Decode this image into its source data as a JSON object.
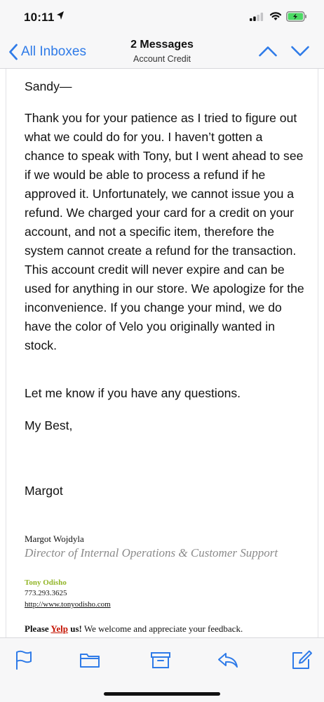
{
  "status_bar": {
    "time": "10:11",
    "icons": [
      "location-arrow-icon",
      "cellular-signal-icon",
      "wifi-icon",
      "battery-charging-icon"
    ]
  },
  "nav": {
    "back_label": "All Inboxes",
    "title": "2 Messages",
    "subtitle": "Account Credit",
    "icons": [
      "chevron-left-icon",
      "chevron-up-icon",
      "chevron-down-icon"
    ]
  },
  "email": {
    "greeting": "Sandy—",
    "paragraphs": [
      "Thank you for your patience as I tried to figure out what we could do for you. I haven’t gotten a chance to speak with Tony, but I went ahead to see if we would be able to process a refund if he approved it. Unfortunately, we cannot issue you a refund. We charged your card for a credit on your account, and not a specific item, therefore the system cannot create a refund for the transaction. This account credit will never expire and can be used for anything in our store. We apologize for the inconvenience. If you change your mind, we do have the color of Velo you originally wanted in stock.",
      "Let me know if you have any questions."
    ],
    "closing": "My Best,",
    "signoff_name": "Margot"
  },
  "signature": {
    "name": "Margot Wojdyla",
    "title": "Director of Internal Operations & Customer Support",
    "company": "Tony Odisho",
    "phone": "773.293.3625",
    "url": "http://www.tonyodisho.com",
    "yelp_prefix": "Please ",
    "yelp_link": "Yelp",
    "yelp_us": " us!",
    "yelp_suffix": " We welcome and appreciate your feedback."
  },
  "toolbar": {
    "icons": [
      "flag-icon",
      "folder-icon",
      "archive-icon",
      "reply-icon",
      "compose-icon"
    ]
  },
  "colors": {
    "accent": "#2f7be8",
    "battery_green": "#4cd964",
    "company_green": "#92b527",
    "yelp_red": "#c41200",
    "bar_background": "#f7f7f8"
  }
}
